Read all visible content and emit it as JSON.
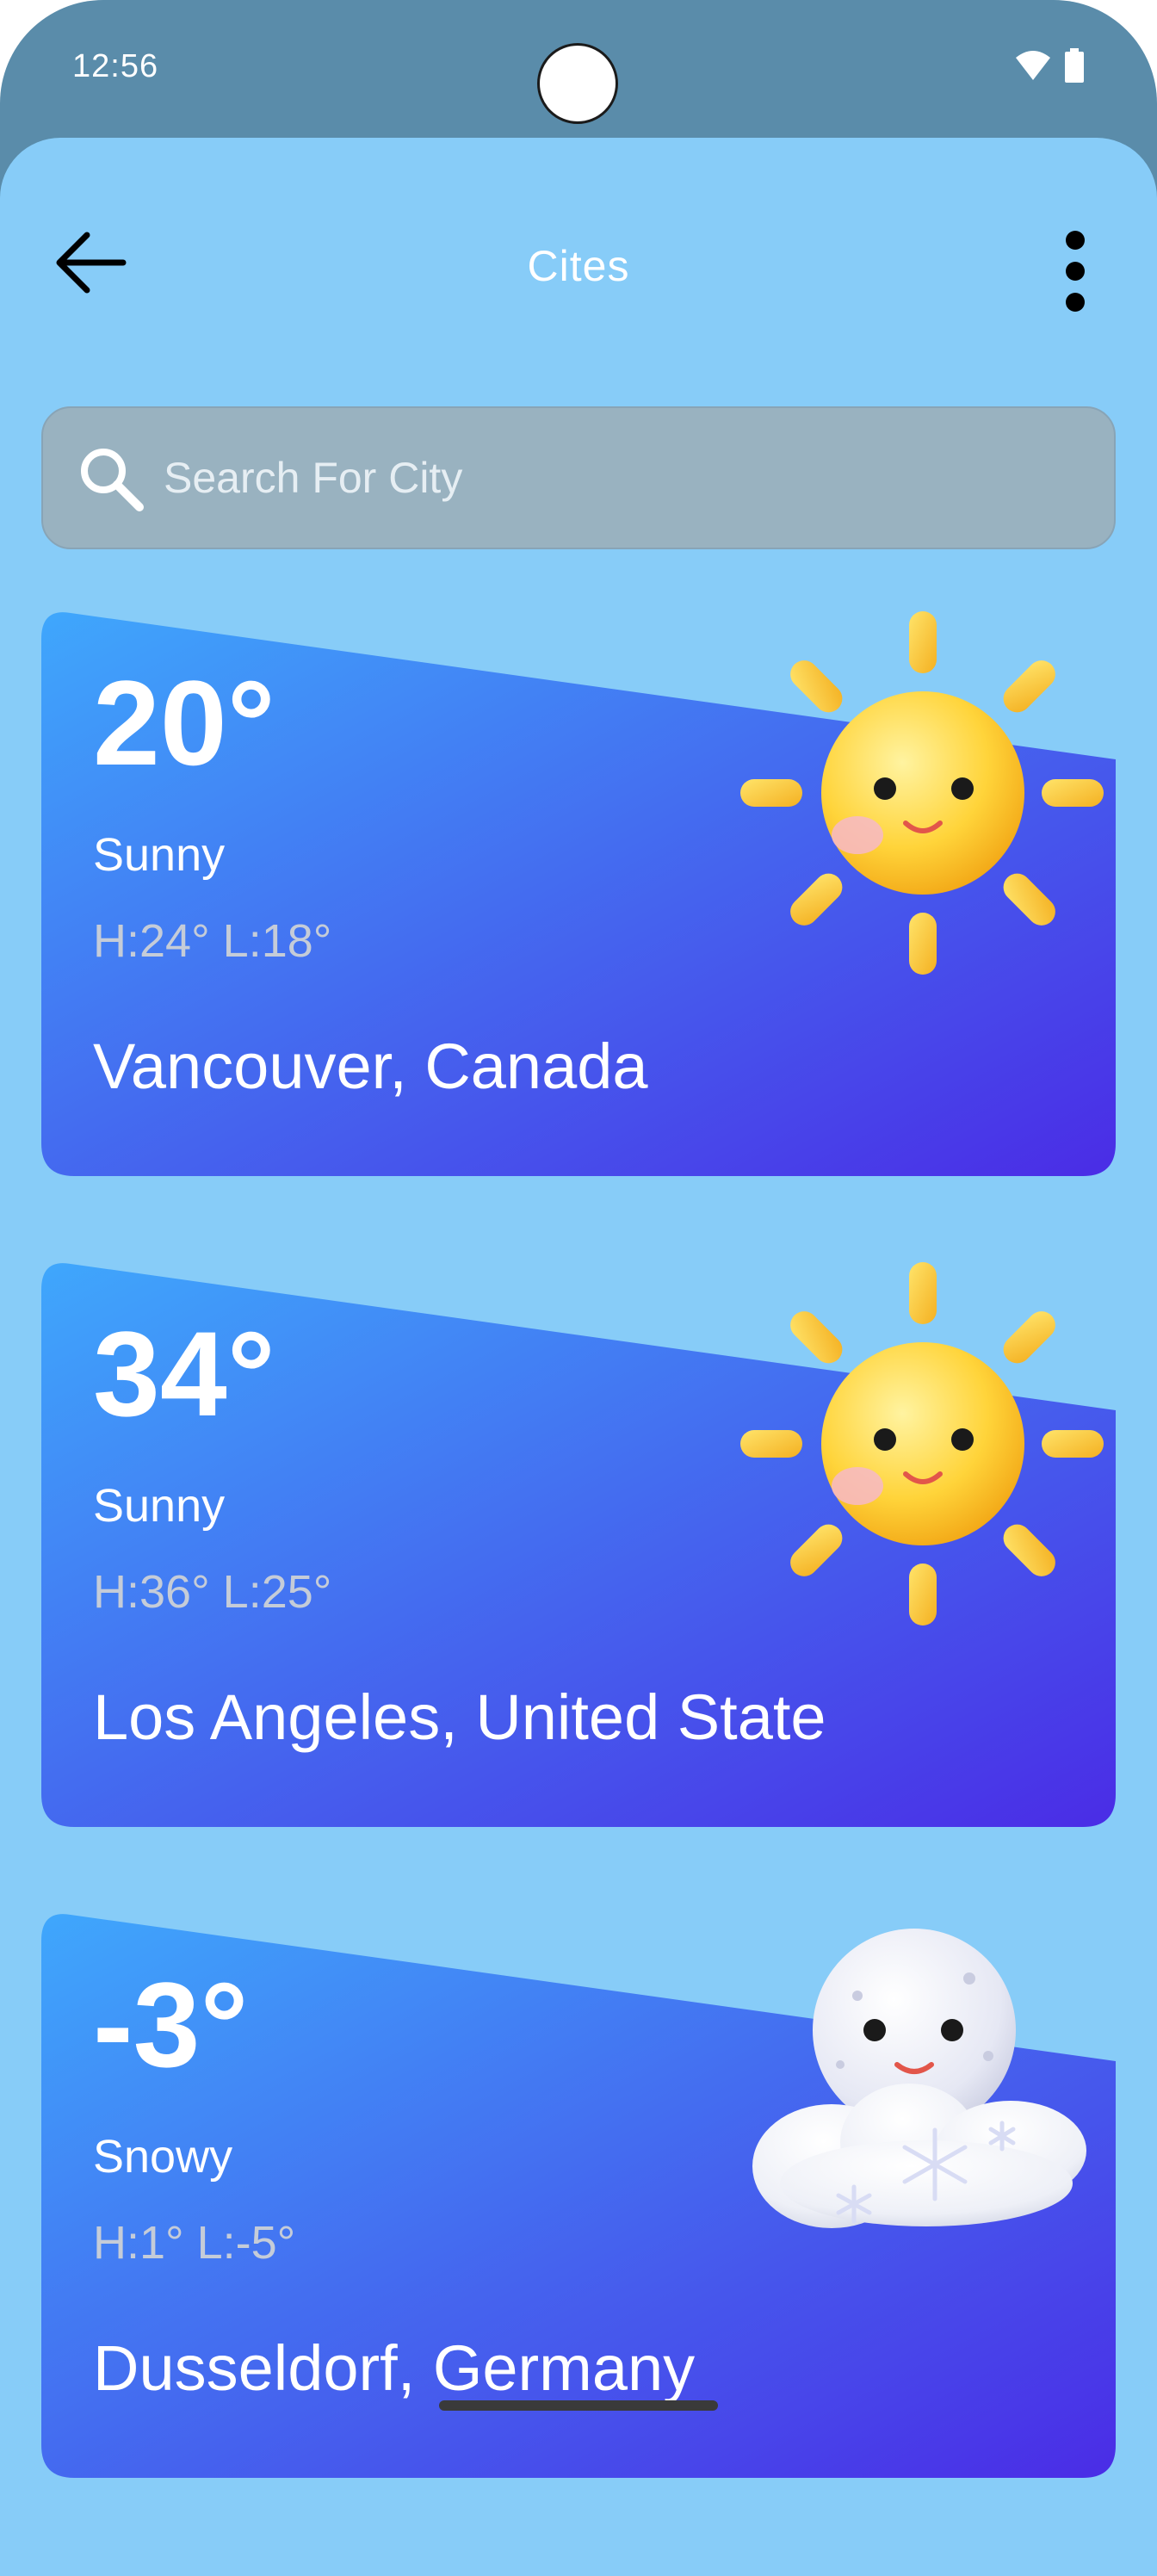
{
  "status_bar": {
    "time": "12:56"
  },
  "header": {
    "title": "Cites",
    "back_icon": "arrow-left-icon",
    "menu_icon": "more-vertical-icon"
  },
  "search": {
    "placeholder": "Search For City",
    "value": "",
    "icon": "search-icon"
  },
  "cities": [
    {
      "temperature": "20°",
      "condition": "Sunny",
      "high_low": "H:24° L:18°",
      "location": "Vancouver, Canada",
      "icon": "sun-icon"
    },
    {
      "temperature": "34°",
      "condition": "Sunny",
      "high_low": "H:36° L:25°",
      "location": "Los Angeles, United State",
      "icon": "sun-icon"
    },
    {
      "temperature": "-3°",
      "condition": "Snowy",
      "high_low": "H:1° L:-5°",
      "location": "Dusseldorf, Germany",
      "icon": "snow-cloud-icon"
    }
  ],
  "colors": {
    "background": "#87ccf8",
    "status_bar": "#5a8caa",
    "card_gradient_start": "#3fa3fb",
    "card_gradient_end": "#4a2de6",
    "search_background": "#99b2c0"
  }
}
